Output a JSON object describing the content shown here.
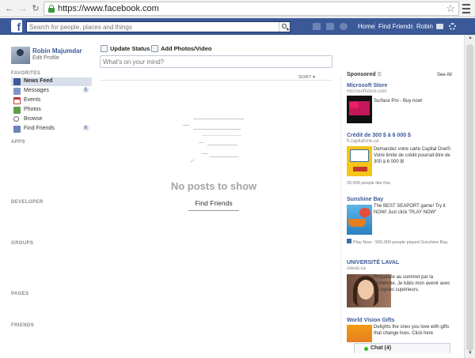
{
  "browser": {
    "url": "https://www.facebook.com",
    "back_icon": "arrow-left-icon",
    "forward_icon": "arrow-right-icon",
    "reload_icon": "reload-icon"
  },
  "topbar": {
    "logo": "f",
    "search_placeholder": "Search for people, places and things",
    "nav": [
      "Home",
      "Find Friends",
      "Robin"
    ],
    "brand_color": "#3b5998"
  },
  "profile": {
    "name": "Robin Majumdar",
    "edit": "Edit Profile"
  },
  "sidebar": {
    "favorites_header": "FAVORITES",
    "items": [
      {
        "label": "News Feed",
        "icon": "news-feed-icon",
        "count": ""
      },
      {
        "label": "Messages",
        "icon": "messages-icon",
        "count": "5"
      },
      {
        "label": "Events",
        "icon": "events-icon",
        "count": ""
      },
      {
        "label": "Photos",
        "icon": "photos-icon",
        "count": ""
      },
      {
        "label": "Browse",
        "icon": "browse-icon",
        "count": ""
      },
      {
        "label": "Find Friends",
        "icon": "find-friends-icon",
        "count": "6"
      }
    ],
    "sections": [
      "APPS",
      "DEVELOPER",
      "GROUPS",
      "PAGES",
      "FRIENDS"
    ]
  },
  "composer": {
    "update_status": "Update Status",
    "add_photos": "Add Photos/Video",
    "placeholder": "What's on your mind?"
  },
  "feed": {
    "sort_label": "SORT",
    "empty_title": "No posts to show",
    "find_friends": "Find Friends"
  },
  "ads": {
    "header": "Sponsored",
    "see_all": "See All",
    "items": [
      {
        "title": "Microsoft Store",
        "domain": "microsoftstore.com",
        "text": "Surface Pro - Buy now!",
        "likes": ""
      },
      {
        "title": "Crédit de 300 $ à 6 000 $",
        "domain": "fr.capitalone.ca",
        "text": "Demandez votre carte Capital One®. Votre limite de crédit pourrait être de 300 à 6 000 $!",
        "likes": "20,499 people like this."
      },
      {
        "title": "Sunshine Bay",
        "domain": "",
        "text": "The BEST SEAPORT game! Try it NOW! Just click \"PLAY NOW\"",
        "likes": "Play Now · 500,000 people played Sunshine Bay."
      },
      {
        "title": "UNIVERSITÉ LAVAL",
        "domain": "ulaval.ca",
        "text": "Propulsée au sommet par la recherche. Je bâtis mon avenir avec les cycles supérieurs.",
        "likes": ""
      },
      {
        "title": "World Vision Gifts",
        "domain": "",
        "text": "Delights the ones you love with gifts that change lives. Click here",
        "likes": ""
      }
    ]
  },
  "chat": {
    "label": "Chat (4)"
  }
}
